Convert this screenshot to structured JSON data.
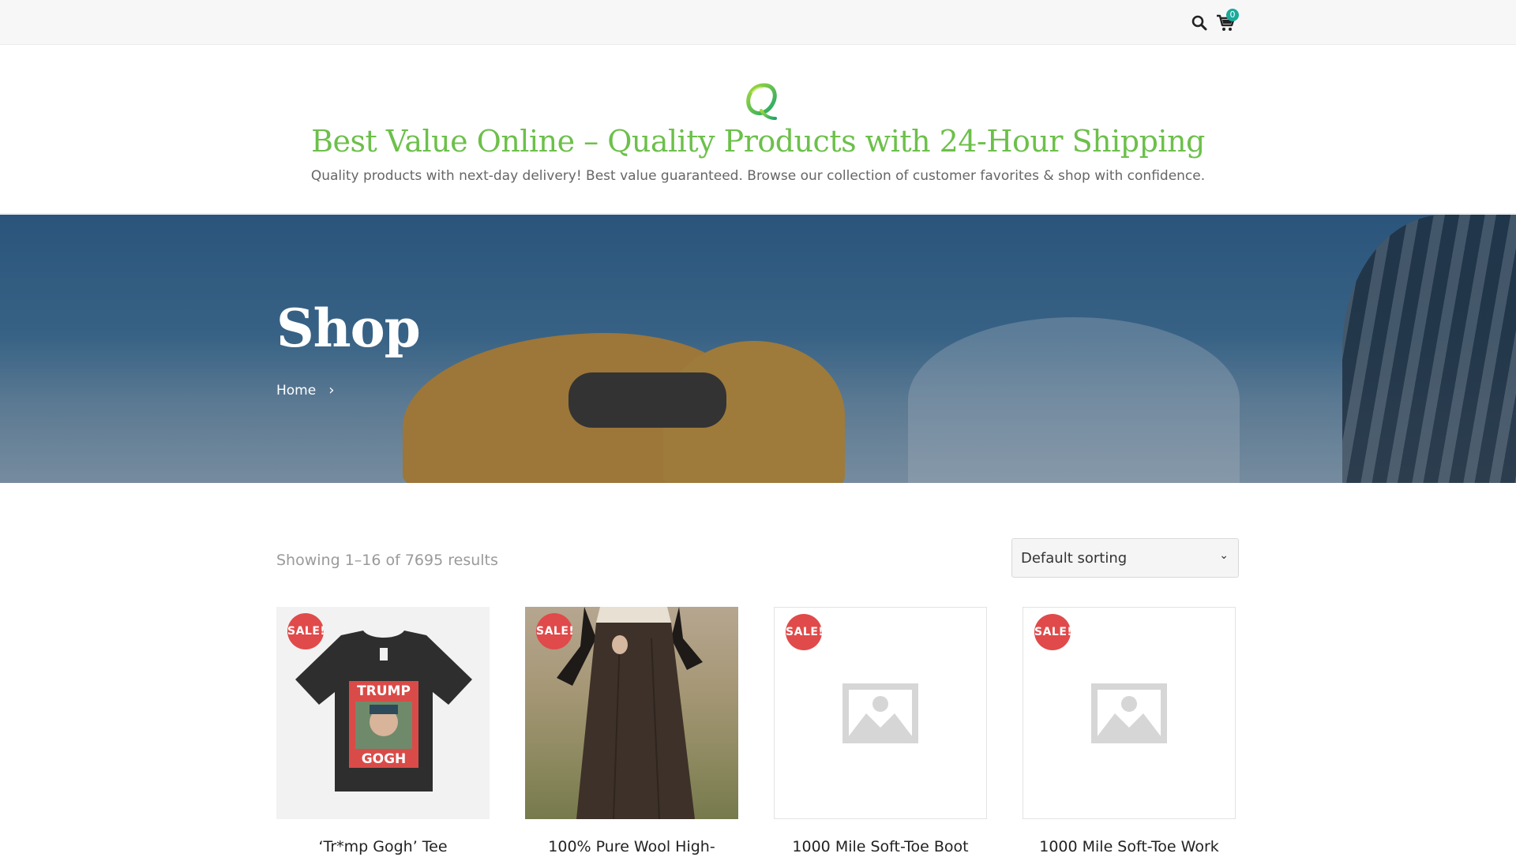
{
  "topbar": {
    "search_icon": "search-icon",
    "cart_icon": "cart-icon",
    "cart_count": "0",
    "accent_color": "#1aa99a"
  },
  "header": {
    "logo_icon": "q-logo-icon",
    "site_title": "Best Value Online – Quality Products with 24-Hour Shipping",
    "tagline": "Quality products with next-day delivery! Best value guaranteed. Browse our collection of customer favorites & shop with confidence.",
    "title_color": "#6cc04a"
  },
  "hero": {
    "title": "Shop",
    "breadcrumb": [
      "Home"
    ]
  },
  "toolbar": {
    "result_count": "Showing 1–16 of 7695 results",
    "sorting_selected": "Default sorting"
  },
  "products": [
    {
      "name": "‘Tr*mp Gogh’ Tee",
      "badge": "SALE!",
      "tee_top_text": "TRUMP",
      "tee_bottom_text": "GOGH"
    },
    {
      "name": "100% Pure Wool High-",
      "badge": "SALE!"
    },
    {
      "name": "1000 Mile Soft-Toe Boot",
      "badge": "SALE!"
    },
    {
      "name": "1000 Mile Soft-Toe Work",
      "badge": "SALE!"
    }
  ],
  "colors": {
    "sale_badge": "#e04a4a",
    "placeholder_gray": "#d6d6d6"
  }
}
